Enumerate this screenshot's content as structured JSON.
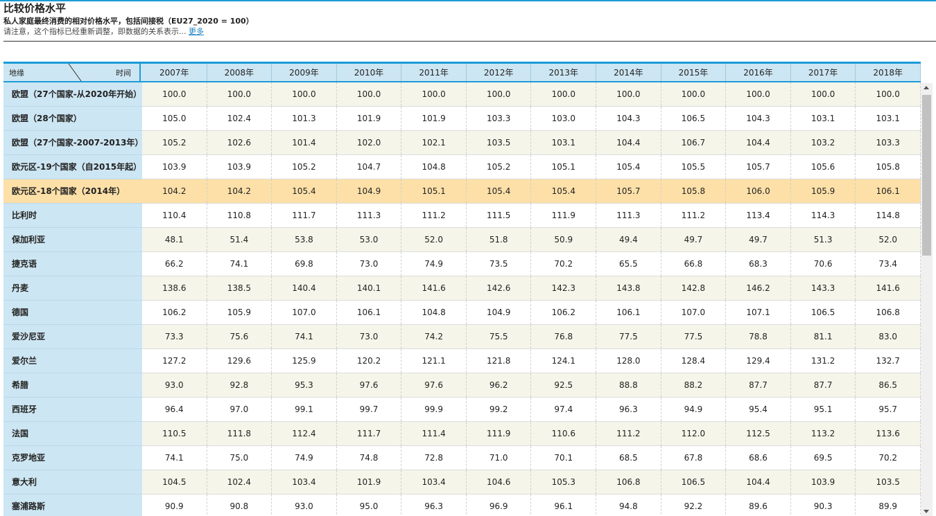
{
  "header": {
    "title": "比较价格水平",
    "subtitle": "私人家庭最终消费的相对价格水平，包括间接税（EU27_2020 = 100）",
    "note": "请注意，这个指标已经重新调整，即数据的关系表示...",
    "more_link": "更多"
  },
  "table": {
    "corner_geo": "地缘",
    "corner_time": "时间",
    "years": [
      "2007年",
      "2008年",
      "2009年",
      "2010年",
      "2011年",
      "2012年",
      "2013年",
      "2014年",
      "2015年",
      "2016年",
      "2017年",
      "2018年"
    ],
    "highlight_color": "#fde0a8",
    "rows": [
      {
        "label": "欧盟（27个国家-从2020年开始）",
        "values": [
          "100.0",
          "100.0",
          "100.0",
          "100.0",
          "100.0",
          "100.0",
          "100.0",
          "100.0",
          "100.0",
          "100.0",
          "100.0",
          "100.0"
        ]
      },
      {
        "label": "欧盟（28个国家）",
        "values": [
          "105.0",
          "102.4",
          "101.3",
          "101.9",
          "101.9",
          "103.3",
          "103.0",
          "104.3",
          "106.5",
          "104.3",
          "103.1",
          "103.1"
        ]
      },
      {
        "label": "欧盟（27个国家-2007-2013年）",
        "values": [
          "105.2",
          "102.6",
          "101.4",
          "102.0",
          "102.1",
          "103.5",
          "103.1",
          "104.4",
          "106.7",
          "104.4",
          "103.2",
          "103.3"
        ]
      },
      {
        "label": "欧元区-19个国家（自2015年起）",
        "values": [
          "103.9",
          "103.9",
          "105.2",
          "104.7",
          "104.8",
          "105.2",
          "105.1",
          "105.4",
          "105.5",
          "105.7",
          "105.6",
          "105.8"
        ]
      },
      {
        "label": "欧元区-18个国家（2014年）",
        "values": [
          "104.2",
          "104.2",
          "105.4",
          "104.9",
          "105.1",
          "105.4",
          "105.4",
          "105.7",
          "105.8",
          "106.0",
          "105.9",
          "106.1"
        ],
        "highlighted": true
      },
      {
        "label": "比利时",
        "values": [
          "110.4",
          "110.8",
          "111.7",
          "111.3",
          "111.2",
          "111.5",
          "111.9",
          "111.3",
          "111.2",
          "113.4",
          "114.3",
          "114.8"
        ]
      },
      {
        "label": "保加利亚",
        "values": [
          "48.1",
          "51.4",
          "53.8",
          "53.0",
          "52.0",
          "51.8",
          "50.9",
          "49.4",
          "49.7",
          "49.7",
          "51.3",
          "52.0"
        ]
      },
      {
        "label": "捷克语",
        "values": [
          "66.2",
          "74.1",
          "69.8",
          "73.0",
          "74.9",
          "73.5",
          "70.2",
          "65.5",
          "66.8",
          "68.3",
          "70.6",
          "73.4"
        ]
      },
      {
        "label": "丹麦",
        "values": [
          "138.6",
          "138.5",
          "140.4",
          "140.1",
          "141.6",
          "142.6",
          "142.3",
          "143.8",
          "142.8",
          "146.2",
          "143.3",
          "141.6"
        ]
      },
      {
        "label": "德国",
        "values": [
          "106.2",
          "105.9",
          "107.0",
          "106.1",
          "104.8",
          "104.9",
          "106.2",
          "106.1",
          "107.0",
          "107.1",
          "106.5",
          "106.8"
        ]
      },
      {
        "label": "爱沙尼亚",
        "values": [
          "73.3",
          "75.6",
          "74.1",
          "73.0",
          "74.2",
          "75.5",
          "76.8",
          "77.5",
          "77.5",
          "78.8",
          "81.1",
          "83.0"
        ]
      },
      {
        "label": "爱尔兰",
        "values": [
          "127.2",
          "129.6",
          "125.9",
          "120.2",
          "121.1",
          "121.8",
          "124.1",
          "128.0",
          "128.4",
          "129.4",
          "131.2",
          "132.7"
        ]
      },
      {
        "label": "希腊",
        "values": [
          "93.0",
          "92.8",
          "95.3",
          "97.6",
          "97.6",
          "96.2",
          "92.5",
          "88.8",
          "88.2",
          "87.7",
          "87.7",
          "86.5"
        ]
      },
      {
        "label": "西班牙",
        "values": [
          "96.4",
          "97.0",
          "99.1",
          "99.7",
          "99.9",
          "99.2",
          "97.4",
          "96.3",
          "94.9",
          "95.4",
          "95.1",
          "95.7"
        ]
      },
      {
        "label": "法国",
        "values": [
          "110.5",
          "111.8",
          "112.4",
          "111.7",
          "111.4",
          "111.9",
          "110.6",
          "111.2",
          "112.0",
          "112.5",
          "113.2",
          "113.6"
        ]
      },
      {
        "label": "克罗地亚",
        "values": [
          "74.1",
          "75.0",
          "74.9",
          "74.8",
          "72.8",
          "71.0",
          "70.1",
          "68.5",
          "67.8",
          "68.6",
          "69.5",
          "70.2"
        ]
      },
      {
        "label": "意大利",
        "values": [
          "104.5",
          "102.4",
          "103.4",
          "101.9",
          "103.4",
          "104.6",
          "105.3",
          "106.8",
          "106.5",
          "104.4",
          "103.9",
          "103.5"
        ]
      },
      {
        "label": "塞浦路斯",
        "values": [
          "90.9",
          "90.8",
          "93.0",
          "95.0",
          "96.3",
          "96.9",
          "96.1",
          "94.8",
          "92.2",
          "89.6",
          "90.3",
          "89.9"
        ]
      }
    ]
  }
}
